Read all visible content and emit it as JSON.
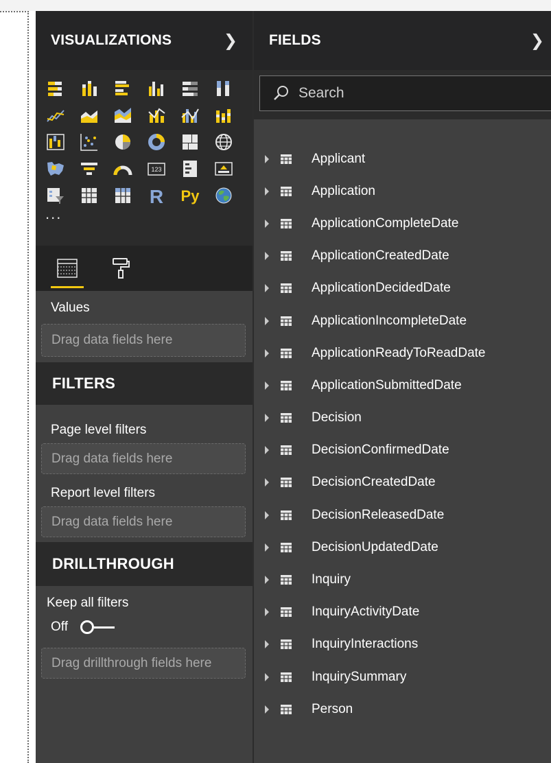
{
  "visualizations": {
    "title": "VISUALIZATIONS",
    "more_label": "...",
    "icons": [
      "stacked-bar-chart-icon",
      "stacked-column-chart-icon",
      "clustered-bar-chart-icon",
      "clustered-column-chart-icon",
      "100-stacked-bar-chart-icon",
      "100-stacked-column-chart-icon",
      "line-chart-icon",
      "area-chart-icon",
      "stacked-area-chart-icon",
      "line-and-column-chart-icon",
      "line-and-clustered-column-chart-icon",
      "ribbon-chart-icon",
      "waterfall-chart-icon",
      "scatter-chart-icon",
      "pie-chart-icon",
      "donut-chart-icon",
      "treemap-icon",
      "map-icon",
      "filled-map-icon",
      "funnel-icon",
      "gauge-icon",
      "card-icon",
      "multi-row-card-icon",
      "kpi-icon",
      "slicer-icon",
      "table-icon",
      "matrix-icon",
      "r-script-visual-icon",
      "python-visual-icon",
      "arcgis-map-icon"
    ],
    "r_text": "R",
    "py_text": "Py",
    "card_text": "123",
    "tabs": [
      "fields-tab-icon",
      "format-paint-roller-icon"
    ],
    "values_label": "Values",
    "values_drop": "Drag data fields here"
  },
  "filters": {
    "title": "FILTERS",
    "page_label": "Page level filters",
    "page_drop": "Drag data fields here",
    "report_label": "Report level filters",
    "report_drop": "Drag data fields here"
  },
  "drillthrough": {
    "title": "DRILLTHROUGH",
    "keep_label": "Keep all filters",
    "toggle_state": "Off",
    "drop": "Drag drillthrough fields here"
  },
  "fields": {
    "title": "FIELDS",
    "search_placeholder": "Search",
    "tables": [
      "Applicant",
      "Application",
      "ApplicationCompleteDate",
      "ApplicationCreatedDate",
      "ApplicationDecidedDate",
      "ApplicationIncompleteDate",
      "ApplicationReadyToReadDate",
      "ApplicationSubmittedDate",
      "Decision",
      "DecisionConfirmedDate",
      "DecisionCreatedDate",
      "DecisionReleasedDate",
      "DecisionUpdatedDate",
      "Inquiry",
      "InquiryActivityDate",
      "InquiryInteractions",
      "InquirySummary",
      "Person"
    ]
  },
  "colors": {
    "accent": "#f2c811",
    "pane_bg": "#404040",
    "header_bg": "#252526"
  }
}
